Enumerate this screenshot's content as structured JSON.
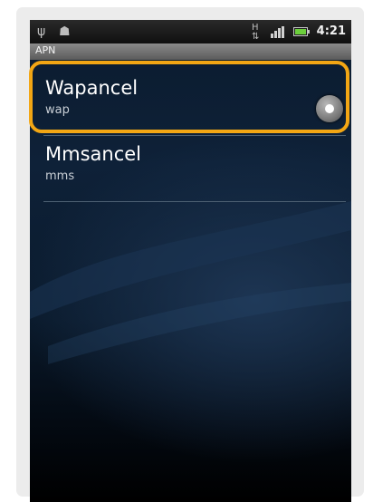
{
  "status_bar": {
    "time": "4:21",
    "icons": [
      "usb-icon",
      "android-debug-icon",
      "data-transfer-icon",
      "signal-bars-icon",
      "battery-icon"
    ]
  },
  "title": "APN",
  "apns": [
    {
      "name": "Wapancel",
      "type": "wap",
      "selected": true
    },
    {
      "name": "Mmsancel",
      "type": "mms",
      "selected": false
    }
  ],
  "colors": {
    "highlight": "#f2a614",
    "background": "#0e2138"
  }
}
